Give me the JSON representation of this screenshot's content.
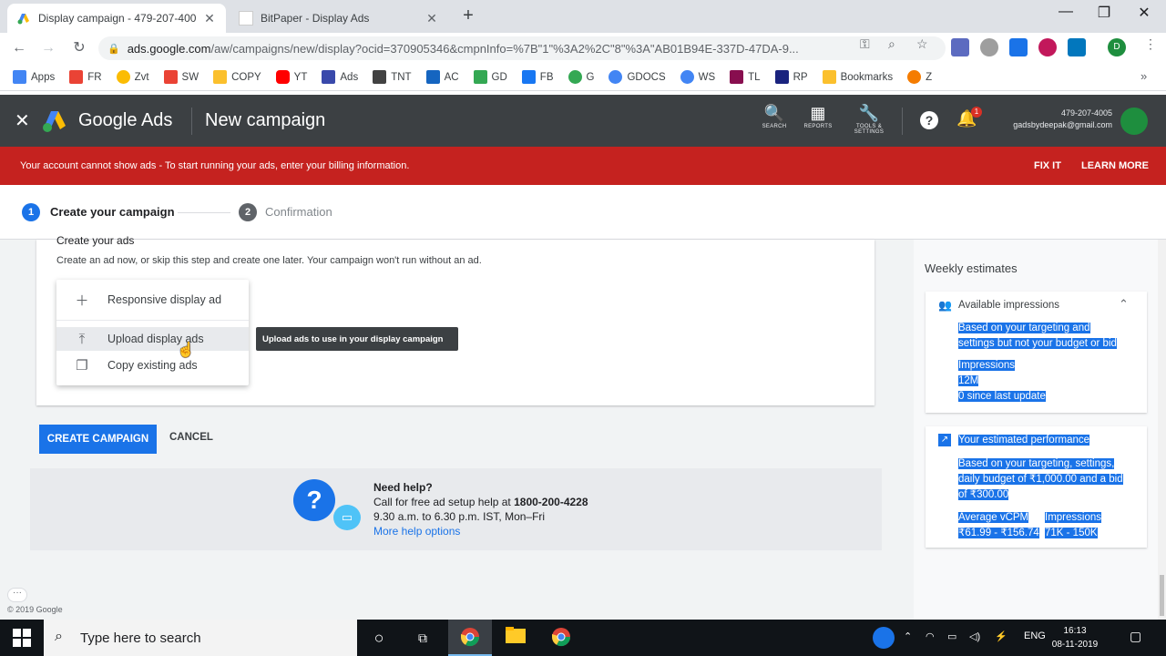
{
  "browser": {
    "tabs": [
      {
        "title": "Display campaign - 479-207-400",
        "active": true
      },
      {
        "title": "BitPaper - Display Ads",
        "active": false
      }
    ],
    "address": {
      "host": "ads.google.com",
      "path": "/aw/campaigns/new/display?ocid=370905346&cmpnInfo=%7B\"1\"%3A2%2C\"8\"%3A\"AB01B94E-337D-47DA-9..."
    },
    "bookmarks": [
      {
        "label": "Apps",
        "color": "#4285f4"
      },
      {
        "label": "FR",
        "color": "#ea4335"
      },
      {
        "label": "Zvt",
        "color": "#fbbc04"
      },
      {
        "label": "SW",
        "color": "#ea4335"
      },
      {
        "label": "COPY",
        "color": "#fbc02d"
      },
      {
        "label": "YT",
        "color": "#ff0000"
      },
      {
        "label": "Ads",
        "color": "#3949ab"
      },
      {
        "label": "TNT",
        "color": "#424242"
      },
      {
        "label": "AC",
        "color": "#1565c0"
      },
      {
        "label": "GD",
        "color": "#34a853"
      },
      {
        "label": "FB",
        "color": "#1877f2"
      },
      {
        "label": "G",
        "color": "#34a853"
      },
      {
        "label": "GDOCS",
        "color": "#4285f4"
      },
      {
        "label": "WS",
        "color": "#4285f4"
      },
      {
        "label": "TL",
        "color": "#880e4f"
      },
      {
        "label": "RP",
        "color": "#1a237e"
      },
      {
        "label": "Bookmarks",
        "color": "#fbc02d"
      },
      {
        "label": "Z",
        "color": "#f57c00"
      }
    ]
  },
  "ads": {
    "brand": "Google Ads",
    "page_title": "New campaign",
    "header_icons": [
      {
        "label": "SEARCH",
        "glyph": "🔍"
      },
      {
        "label": "REPORTS",
        "glyph": "▦"
      },
      {
        "label": "TOOLS & SETTINGS",
        "glyph": "🔧"
      }
    ],
    "notification_count": "1",
    "account_id": "479-207-4005",
    "account_email": "gadsbydeepak@gmail.com",
    "alert": {
      "message": "Your account cannot show ads - To start running your ads, enter your billing information.",
      "fix": "FIX IT",
      "learn": "LEARN MORE"
    },
    "steps": [
      {
        "num": "1",
        "label": "Create your campaign"
      },
      {
        "num": "2",
        "label": "Confirmation"
      }
    ],
    "create_ads": {
      "title": "Create your ads",
      "desc": "Create an ad now, or skip this step and create one later. Your campaign won't run without an ad."
    },
    "menu": [
      {
        "label": "Responsive display ad",
        "icon": "plus-icon"
      },
      {
        "label": "Upload display ads",
        "icon": "upload-icon"
      },
      {
        "label": "Copy existing ads",
        "icon": "copy-icon"
      }
    ],
    "tooltip": "Upload ads to use in your display campaign",
    "create_button": "CREATE CAMPAIGN",
    "cancel_button": "CANCEL",
    "help": {
      "title": "Need help?",
      "call_prefix": "Call for free ad setup help at",
      "phone": "1800-200-4228",
      "hours": "9.30 a.m. to 6.30 p.m. IST, Mon–Fri",
      "more": "More help options"
    },
    "copyright": "© 2019 Google",
    "side": {
      "title": "Weekly estimates",
      "impressions_card": {
        "heading": "Available impressions",
        "lines": [
          "Based on your targeting and",
          "settings but not your budget or bid",
          "Impressions",
          "12M",
          "0 since last update"
        ]
      },
      "perf_card": {
        "heading": "Your estimated performance",
        "lines": [
          "Based on your targeting, settings,",
          "daily budget of ₹1,000.00 and a bid",
          "of ₹300.00"
        ],
        "col1_label": "Average vCPM",
        "col1_value": "₹61.99 - ₹156.74",
        "col2_label": "Impressions",
        "col2_value": "71K - 150K"
      }
    }
  },
  "taskbar": {
    "search_placeholder": "Type here to search",
    "lang": "ENG",
    "time": "16:13",
    "date": "08-11-2019"
  }
}
